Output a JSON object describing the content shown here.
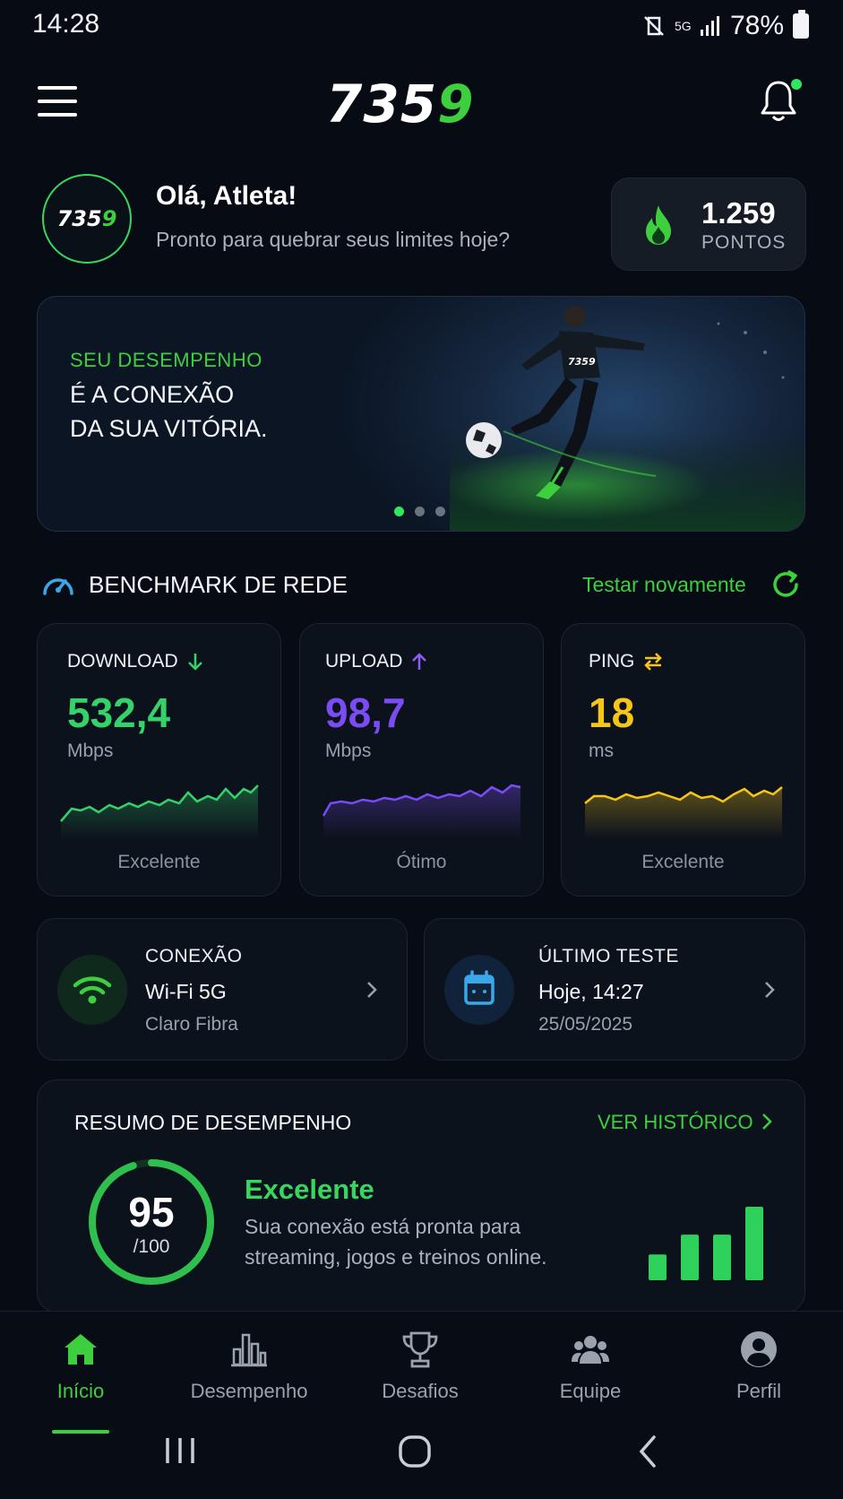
{
  "status_bar": {
    "time": "14:28",
    "network": "5G",
    "battery": "78%"
  },
  "header": {
    "logo_white": "735",
    "logo_green": "9"
  },
  "greeting": {
    "avatar_white": "735",
    "avatar_green": "9",
    "title": "Olá, Atleta!",
    "subtitle": "Pronto para quebrar seus limites hoje?"
  },
  "points": {
    "value": "1.259",
    "label": "PONTOS"
  },
  "hero": {
    "kicker": "SEU DESEMPENHO",
    "line1": "É A CONEXÃO",
    "line2": "DA SUA VITÓRIA.",
    "jersey_text": "7359",
    "slides": 3,
    "active_slide": 1
  },
  "benchmark": {
    "title": "BENCHMARK DE REDE",
    "retest_label": "Testar novamente",
    "metrics": [
      {
        "label": "DOWNLOAD",
        "value": "532,4",
        "unit": "Mbps",
        "rating": "Excelente",
        "color": "#35d26b",
        "icon": "arrow-down-icon"
      },
      {
        "label": "UPLOAD",
        "value": "98,7",
        "unit": "Mbps",
        "rating": "Ótimo",
        "color": "#7b4cf5",
        "icon": "arrow-up-icon"
      },
      {
        "label": "PING",
        "value": "18",
        "unit": "ms",
        "rating": "Excelente",
        "color": "#f5c518",
        "icon": "swap-arrows-icon"
      }
    ]
  },
  "connection": {
    "label": "CONEXÃO",
    "value": "Wi-Fi 5G",
    "provider": "Claro Fibra"
  },
  "last_test": {
    "label": "ÚLTIMO TESTE",
    "value": "Hoje, 14:27",
    "date": "25/05/2025"
  },
  "summary": {
    "title": "RESUMO DE DESEMPENHO",
    "link": "VER HISTÓRICO",
    "score": "95",
    "score_max": "/100",
    "score_fraction": 0.95,
    "headline": "Excelente",
    "desc_line1": "Sua conexão está pronta para",
    "desc_line2": "streaming, jogos e treinos online.",
    "signal_levels": [
      0.35,
      0.62,
      0.62,
      1.0
    ]
  },
  "nav": [
    {
      "label": "Início",
      "icon": "home-icon",
      "active": true
    },
    {
      "label": "Desempenho",
      "icon": "bar-chart-icon",
      "active": false
    },
    {
      "label": "Desafios",
      "icon": "trophy-icon",
      "active": false
    },
    {
      "label": "Equipe",
      "icon": "team-icon",
      "active": false
    },
    {
      "label": "Perfil",
      "icon": "profile-icon",
      "active": false
    }
  ],
  "colors": {
    "accent": "#3ecf3e",
    "background": "#060b14",
    "card": "#0c121c"
  }
}
